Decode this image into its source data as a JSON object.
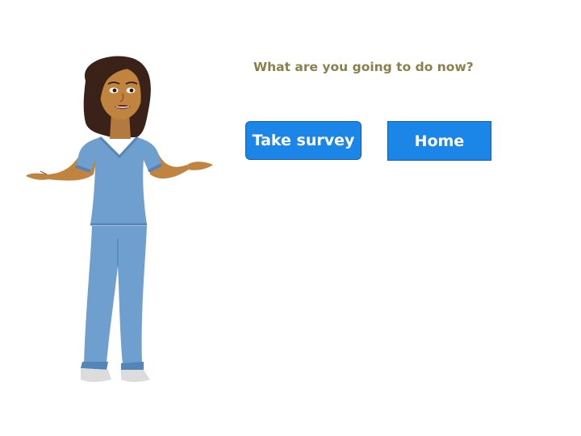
{
  "prompt": {
    "text": "What are you going to do now?",
    "color": "#8b7f4b"
  },
  "buttons": {
    "take_survey_label": "Take survey",
    "home_label": "Home",
    "color": "#1c86e8"
  },
  "character": {
    "description": "nurse-character-shrugging"
  }
}
